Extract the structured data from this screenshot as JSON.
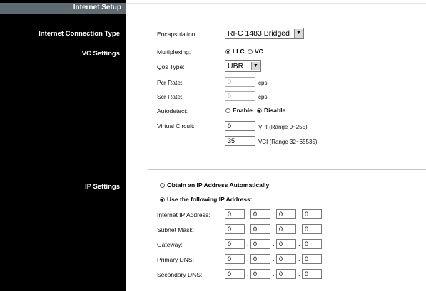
{
  "sidebar": {
    "header": "Internet Setup",
    "items": [
      {
        "label": "Internet Connection Type"
      },
      {
        "label": "VC Settings"
      },
      {
        "label": "IP Settings"
      }
    ]
  },
  "vc": {
    "encapsulation": {
      "label": "Encapsulation:",
      "value": "RFC 1483 Bridged"
    },
    "multiplexing": {
      "label": "Multiplexing:",
      "options": [
        "LLC",
        "VC"
      ],
      "selected": "LLC"
    },
    "qos_type": {
      "label": "Qos Type:",
      "value": "UBR"
    },
    "pcr_rate": {
      "label": "Pcr Rate:",
      "value": "0",
      "unit": "cps"
    },
    "scr_rate": {
      "label": "Scr Rate:",
      "value": "0",
      "unit": "cps"
    },
    "autodetect": {
      "label": "Autodetect:",
      "options": [
        "Enable",
        "Disable"
      ],
      "selected": "Disable"
    },
    "virtual_circuit": {
      "label": "Virtual Circuit:",
      "vpi": {
        "value": "0",
        "hint": "VPI (Range 0~255)"
      },
      "vci": {
        "value": "35",
        "hint": "VCI (Range 32~65535)"
      }
    }
  },
  "ip": {
    "obtain_auto": "Obtain an IP Address Automatically",
    "use_following": "Use the following IP Address:",
    "selected": "use_following",
    "fields": [
      {
        "label": "Internet IP Address:",
        "octets": [
          "0",
          "0",
          "0",
          "0"
        ]
      },
      {
        "label": "Subnet Mask:",
        "octets": [
          "0",
          "0",
          "0",
          "0"
        ]
      },
      {
        "label": "Gateway:",
        "octets": [
          "0",
          "0",
          "0",
          "0"
        ]
      },
      {
        "label": "Primary DNS:",
        "octets": [
          "0",
          "0",
          "0",
          "0"
        ]
      },
      {
        "label": "Secondary DNS:",
        "octets": [
          "0",
          "0",
          "0",
          "0"
        ]
      }
    ]
  },
  "colors": {
    "sidebar_bg": "#000000",
    "sidebar_header_bg": "#5e6b71",
    "page_bg": "#ffffff"
  }
}
